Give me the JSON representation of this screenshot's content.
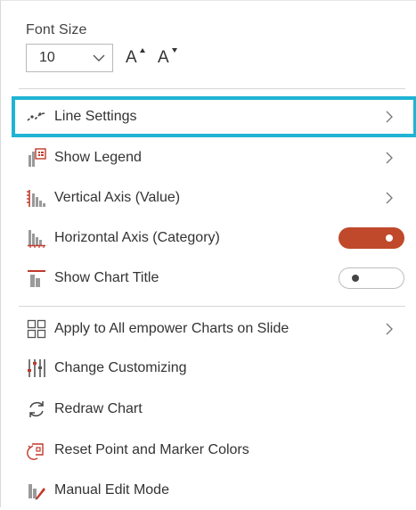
{
  "font_size": {
    "label": "Font Size",
    "value": "10",
    "increase_label": "A",
    "decrease_label": "A"
  },
  "menu": {
    "line_settings": "Line Settings",
    "show_legend": "Show Legend",
    "vertical_axis": "Vertical Axis (Value)",
    "horizontal_axis": "Horizontal Axis (Category)",
    "show_chart_title": "Show Chart Title",
    "apply_all": "Apply to All empower Charts on Slide",
    "change_customizing": "Change Customizing",
    "redraw_chart": "Redraw Chart",
    "reset_colors": "Reset Point and Marker Colors",
    "manual_edit": "Manual Edit Mode"
  },
  "toggles": {
    "horizontal_axis_on": true,
    "show_chart_title_on": false
  },
  "colors": {
    "accent": "#c0492b",
    "selection": "#1fb3d4",
    "icon_gray": "#8c8c8c",
    "icon_red": "#c0392b"
  }
}
